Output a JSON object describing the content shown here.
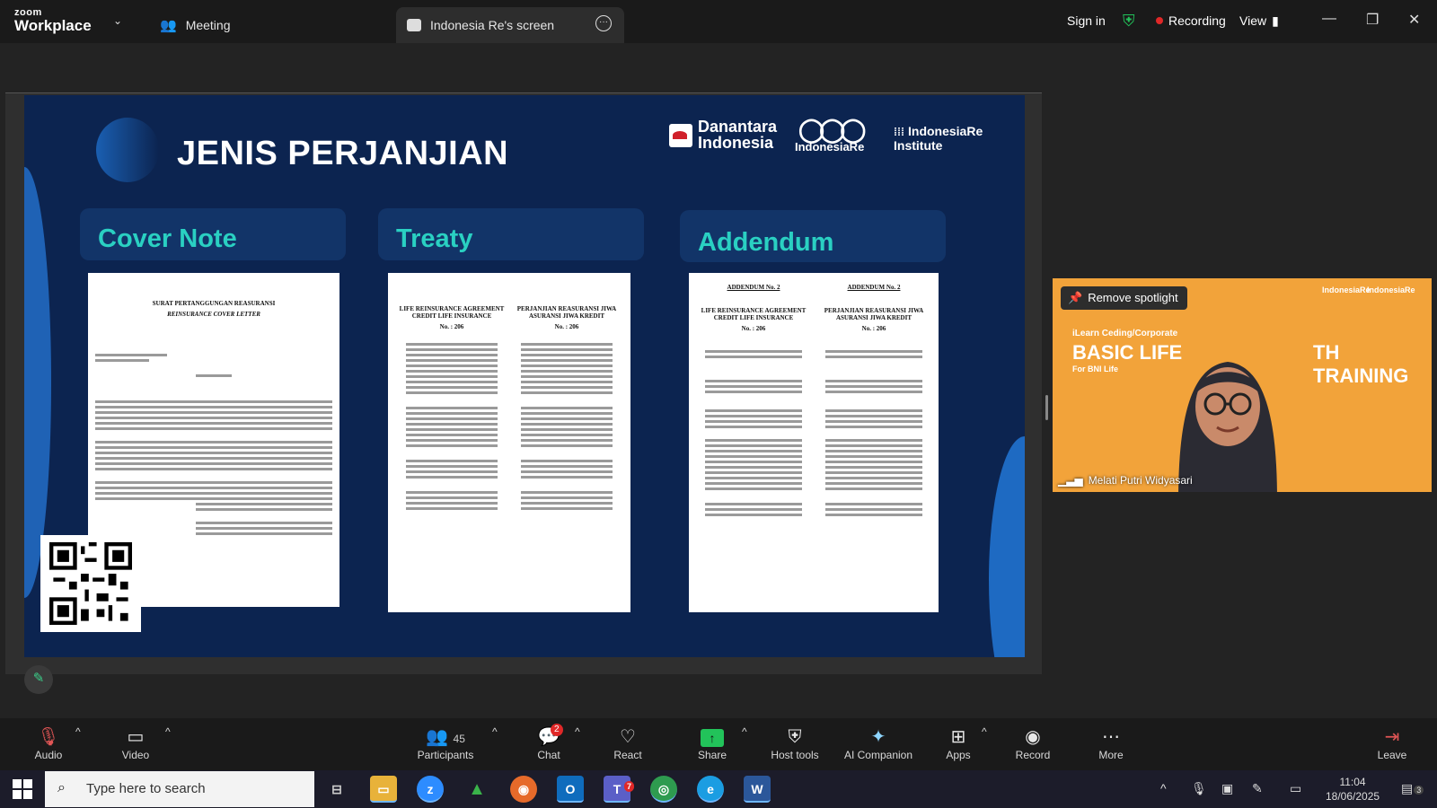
{
  "app": {
    "brand_top": "zoom",
    "brand_bottom": "Workplace"
  },
  "tabs": {
    "meeting": "Meeting",
    "screen": "Indonesia Re's screen"
  },
  "header": {
    "sign_in": "Sign in",
    "recording": "Recording",
    "view": "View"
  },
  "slide": {
    "title": "JENIS PERJANJIAN",
    "brands": {
      "danantara_1": "Danantara",
      "danantara_2": "Indonesia",
      "indonesiare": "IndonesiaRe",
      "institute": "IndonesiaRe Institute"
    },
    "cards": [
      {
        "label": "Cover Note"
      },
      {
        "label": "Treaty"
      },
      {
        "label": "Addendum"
      }
    ],
    "doc_treaty": {
      "left_title": "LIFE REINSURANCE AGREEMENT CREDIT LIFE INSURANCE",
      "right_title": "PERJANJIAN REASURANSI JIWA ASURANSI JIWA KREDIT",
      "no": "No. : 206"
    },
    "doc_addendum": {
      "left_head": "ADDENDUM No. 2",
      "right_head": "ADDENDUM No. 2",
      "left_title": "LIFE REINSURANCE AGREEMENT CREDIT LIFE INSURANCE",
      "right_title": "PERJANJIAN REASURANSI JIWA ASURANSI JIWA KREDIT",
      "no": "No. : 206"
    },
    "doc_cover": {
      "title": "SURAT PERTANGGUNGAN REASURANSI",
      "subtitle": "REINSURANCE COVER LETTER"
    }
  },
  "video": {
    "spotlight": "Remove spotlight",
    "name": "Melati Putri Widyasari",
    "banner_small": "iLearn Ceding/Corporate",
    "banner_big": "BASIC LIFE",
    "banner_big2": "TH TRAINING",
    "banner_sub": "For BNI Life",
    "logo_a": "IndonesiaRe",
    "logo_b": "IndonesiaRe"
  },
  "toolbar": {
    "audio": "Audio",
    "video": "Video",
    "participants": "Participants",
    "participants_count": "45",
    "chat": "Chat",
    "chat_badge": "2",
    "react": "React",
    "share": "Share",
    "host_tools": "Host tools",
    "ai": "AI Companion",
    "apps": "Apps",
    "record": "Record",
    "more": "More",
    "leave": "Leave"
  },
  "taskbar": {
    "search_placeholder": "Type here to search",
    "time": "11:04",
    "date": "18/06/2025",
    "notif": "3",
    "teams_badge": "7"
  }
}
